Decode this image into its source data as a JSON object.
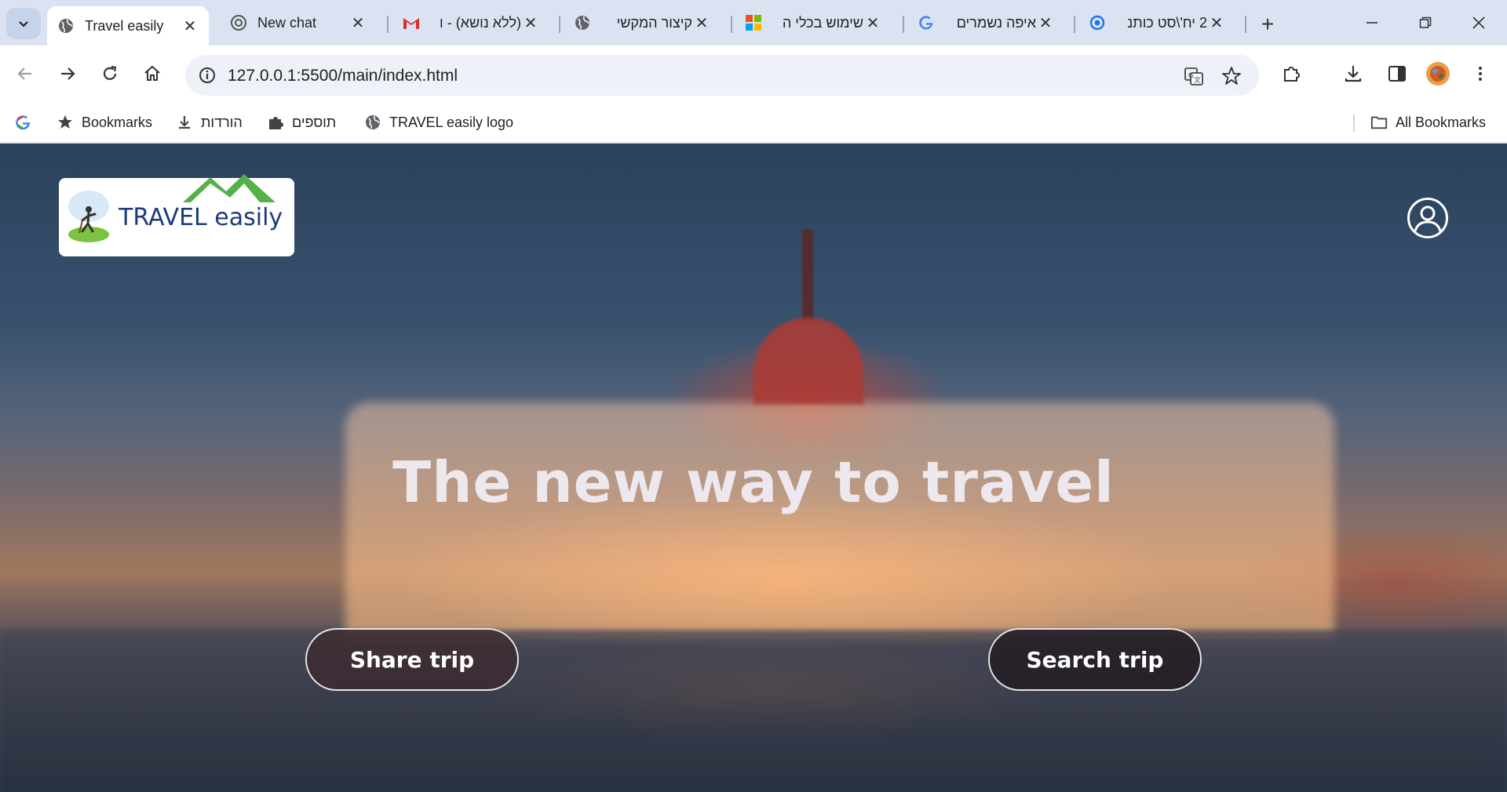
{
  "tabs": [
    {
      "title": "Travel easily",
      "favicon": "globe-icon",
      "active": true
    },
    {
      "title": "New chat",
      "favicon": "chatgpt-icon",
      "active": false
    },
    {
      "title": "(ללא נושא) - ו",
      "favicon": "gmail-icon",
      "active": false
    },
    {
      "title": "קיצור המקשי",
      "favicon": "globe-icon",
      "active": false
    },
    {
      "title": "שימוש בכלי ה",
      "favicon": "microsoft-icon",
      "active": false
    },
    {
      "title": "איפה נשמרים",
      "favicon": "google-icon",
      "active": false
    },
    {
      "title": "2 יח'\\סט כותנ",
      "favicon": "eye-icon",
      "active": false
    }
  ],
  "toolbar": {
    "url": "127.0.0.1:5500/main/index.html"
  },
  "bookmarks": {
    "items": [
      {
        "label": "Bookmarks",
        "icon": "star-icon"
      },
      {
        "label": "הורדות",
        "icon": "download-icon"
      },
      {
        "label": "תוספים",
        "icon": "puzzle-icon"
      },
      {
        "label": "TRAVEL easily logo",
        "icon": "globe-icon"
      }
    ],
    "all_bookmarks": "All Bookmarks"
  },
  "page": {
    "logo_text": "TRAVEL easily",
    "headline": "The new way to travel",
    "share_button": "Share trip",
    "search_button": "Search trip"
  },
  "colors": {
    "tabstrip": "#dbe3f3",
    "logo_text": "#1c3a7a",
    "logo_mountains": "#55b04a"
  }
}
